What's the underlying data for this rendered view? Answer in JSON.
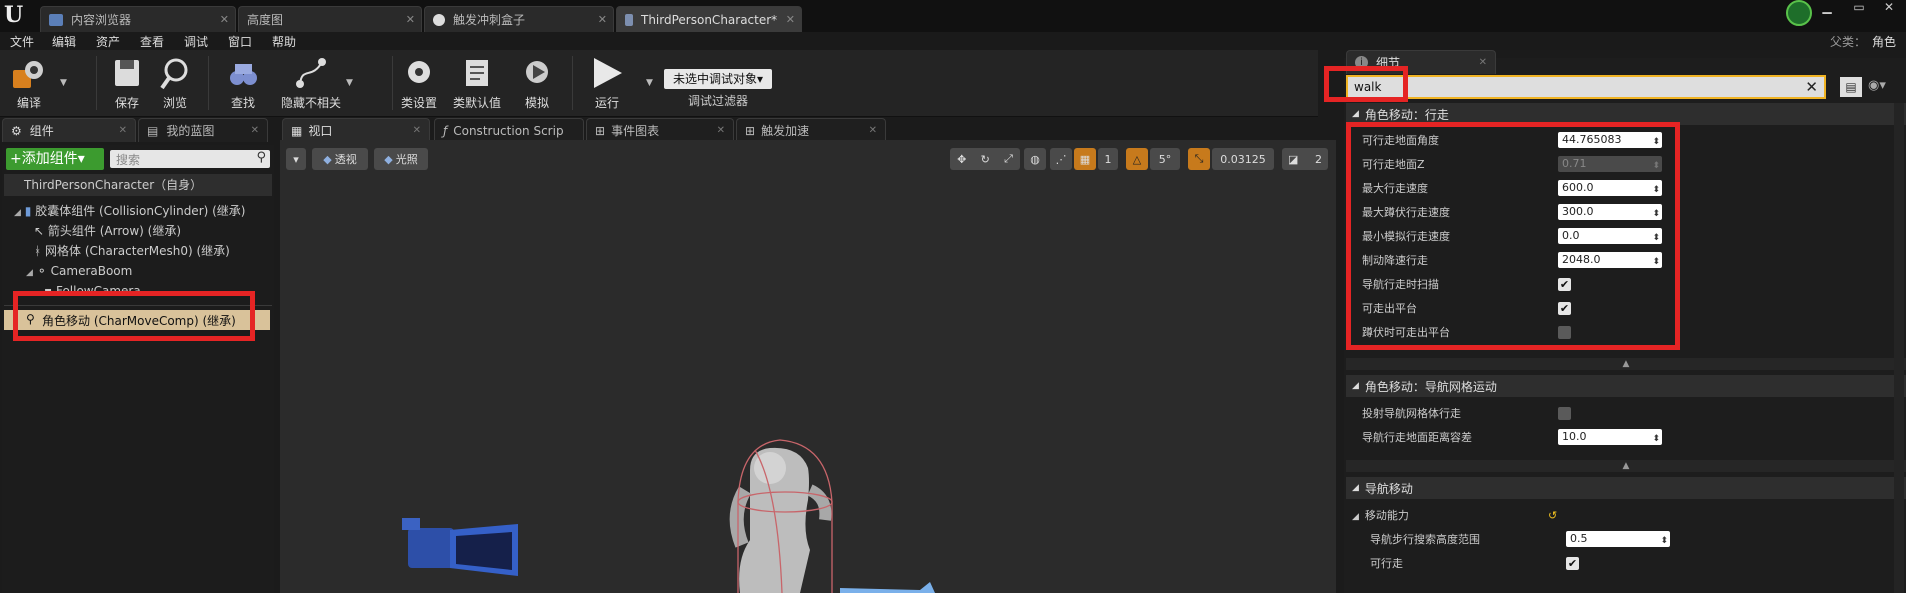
{
  "doc_tabs": [
    {
      "label": "内容浏览器",
      "active": false
    },
    {
      "label": "高度图",
      "active": false
    },
    {
      "label": "触发冲刺盒子",
      "active": false
    },
    {
      "label": "ThirdPersonCharacter*",
      "active": true
    }
  ],
  "menu": [
    "文件",
    "编辑",
    "资产",
    "查看",
    "调试",
    "窗口",
    "帮助"
  ],
  "parent_class": {
    "label": "父类：",
    "value": "角色"
  },
  "toolbar": {
    "compile": "编译",
    "save": "保存",
    "browse": "浏览",
    "find": "查找",
    "hide_unrelated": "隐藏不相关",
    "class_settings": "类设置",
    "class_defaults": "类默认值",
    "simulate": "模拟",
    "run": "运行",
    "debug_target": "未选中调试对象▾",
    "debug_filter": "调试过滤器"
  },
  "left_tabs": [
    "组件",
    "我的蓝图"
  ],
  "components": {
    "add_button": "+添加组件▾",
    "search_placeholder": "搜索",
    "root": "ThirdPersonCharacter（自身）",
    "items": [
      "胶囊体组件 (CollisionCylinder) (继承)",
      "箭头组件 (Arrow) (继承)",
      "网格体 (CharacterMesh0) (继承)",
      "CameraBoom",
      "FollowCamera"
    ],
    "selected": "角色移动 (CharMoveComp) (继承)"
  },
  "editor_tabs": [
    "视口",
    "Construction Scrip",
    "事件图表",
    "触发加速"
  ],
  "viewport": {
    "perspective": "透视",
    "lit": "光照",
    "rot_snap": "5°",
    "scale_snap": "0.03125",
    "cam_speed": "2",
    "grid": "1"
  },
  "details": {
    "tab": "细节",
    "search_value": "walk",
    "categories": [
      {
        "title": "角色移动：行走",
        "rows": [
          {
            "label": "可行走地面角度",
            "type": "number",
            "value": "44.765083"
          },
          {
            "label": "可行走地面Z",
            "type": "number",
            "value": "0.71",
            "disabled": true
          },
          {
            "label": "最大行走速度",
            "type": "number",
            "value": "600.0"
          },
          {
            "label": "最大蹲伏行走速度",
            "type": "number",
            "value": "300.0"
          },
          {
            "label": "最小模拟行走速度",
            "type": "number",
            "value": "0.0"
          },
          {
            "label": "制动降速行走",
            "type": "number",
            "value": "2048.0"
          },
          {
            "label": "导航行走时扫描",
            "type": "check",
            "checked": true
          },
          {
            "label": "可走出平台",
            "type": "check",
            "checked": true
          },
          {
            "label": "蹲伏时可走出平台",
            "type": "check",
            "checked": false
          }
        ]
      },
      {
        "title": "角色移动：导航网格运动",
        "rows": [
          {
            "label": "投射导航网格体行走",
            "type": "check",
            "checked": false
          },
          {
            "label": "导航行走地面距离容差",
            "type": "number",
            "value": "10.0"
          }
        ]
      },
      {
        "title": "导航移动",
        "rows": [
          {
            "label": "移动能力",
            "type": "reset"
          },
          {
            "label": "导航步行搜索高度范围",
            "type": "number",
            "value": "0.5"
          },
          {
            "label": "可行走",
            "type": "check",
            "checked": true
          }
        ]
      }
    ]
  },
  "colors": {
    "highlight": "#e52424",
    "selected_row": "#d9c29a",
    "accent_green": "#3c9b2f",
    "orange": "#c77a1c"
  }
}
